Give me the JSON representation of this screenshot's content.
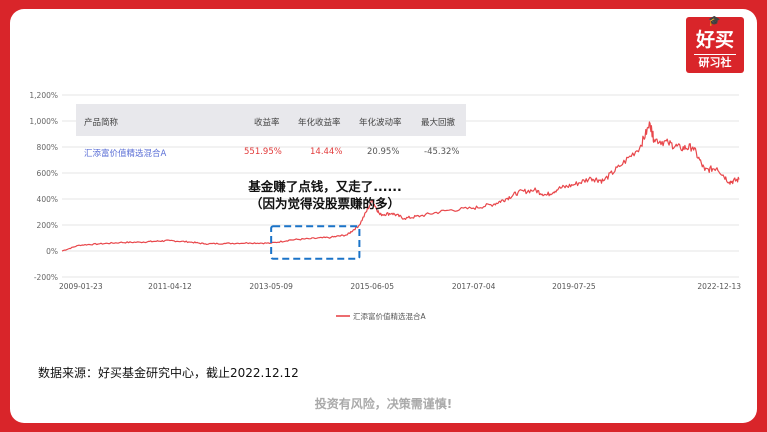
{
  "logo": {
    "cap_icon": "graduation-cap-icon",
    "line1": "好买",
    "line2": "研习社"
  },
  "table": {
    "headers": [
      "产品简称",
      "收益率",
      "年化收益率",
      "年化波动率",
      "最大回撤"
    ],
    "row": [
      "汇添富价值精选混合A",
      "551.95%",
      "14.44%",
      "20.95%",
      "-45.32%"
    ],
    "colors": {
      "name": "#5b6fd6",
      "positive": "#e23b3b",
      "normal": "#555555",
      "header_bg": "#e8e8ec"
    }
  },
  "annotation": {
    "line1": "基金赚了点钱，又走了......",
    "line2": "（因为觉得没股票赚的多）"
  },
  "source": "数据来源：好买基金研究中心，截止2022.12.12",
  "risk": "投资有风险，决策需谨慎!",
  "chart_data": {
    "type": "line",
    "title": "",
    "xlabel": "",
    "ylabel": "",
    "ylim": [
      -200,
      1200
    ],
    "y_ticks": [
      "-200%",
      "0%",
      "200%",
      "400%",
      "600%",
      "800%",
      "1,000%",
      "1,200%"
    ],
    "x_ticks": [
      "2009-01-23",
      "2011-04-12",
      "2013-05-09",
      "2015-06-05",
      "2017-07-04",
      "2019-07-25",
      "2022-12-13"
    ],
    "grid": true,
    "legend": "bottom",
    "highlight_box": {
      "x_range": [
        "2013-05-09",
        "2015-03-01"
      ],
      "y_range": [
        -60,
        190
      ],
      "color": "#1a73c8"
    },
    "series": [
      {
        "name": "汇添富价值精选混合A",
        "color": "#e8474b",
        "x": [
          "2009-01-23",
          "2009-06-01",
          "2009-11-01",
          "2010-04-01",
          "2010-09-01",
          "2011-01-01",
          "2011-04-12",
          "2011-09-01",
          "2012-01-01",
          "2012-06-01",
          "2012-12-01",
          "2013-05-09",
          "2013-10-01",
          "2014-03-01",
          "2014-08-01",
          "2014-12-01",
          "2015-03-01",
          "2015-06-05",
          "2015-08-01",
          "2015-11-01",
          "2016-02-01",
          "2016-06-01",
          "2016-12-01",
          "2017-07-04",
          "2017-12-01",
          "2018-03-01",
          "2018-06-01",
          "2018-10-01",
          "2019-01-01",
          "2019-04-01",
          "2019-07-25",
          "2019-12-01",
          "2020-03-01",
          "2020-07-01",
          "2020-12-01",
          "2021-02-15",
          "2021-03-15",
          "2021-07-01",
          "2021-10-01",
          "2022-01-01",
          "2022-04-01",
          "2022-07-01",
          "2022-10-01",
          "2022-12-13"
        ],
        "values": [
          0,
          45,
          55,
          65,
          68,
          75,
          80,
          70,
          55,
          58,
          62,
          60,
          85,
          95,
          105,
          125,
          200,
          390,
          280,
          290,
          250,
          270,
          310,
          330,
          360,
          400,
          450,
          470,
          430,
          480,
          510,
          560,
          540,
          650,
          800,
          980,
          860,
          830,
          790,
          800,
          620,
          640,
          530,
          550
        ]
      }
    ]
  }
}
